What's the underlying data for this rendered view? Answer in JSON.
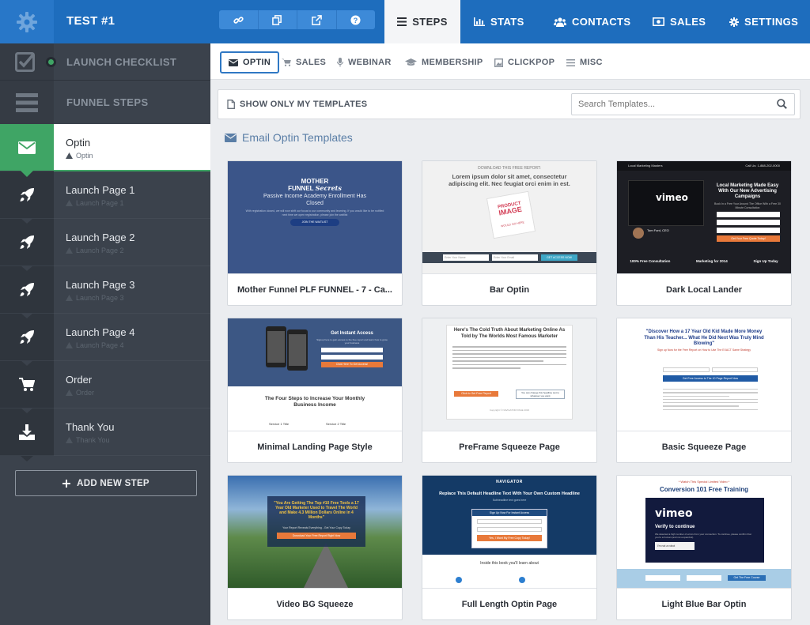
{
  "app": {
    "title": "TEST #1"
  },
  "toolbar": {
    "icons": [
      "link-icon",
      "copy-icon",
      "external-link-icon",
      "help-icon"
    ]
  },
  "nav": {
    "tabs": [
      {
        "label": "STEPS",
        "icon": "list-icon",
        "active": true
      },
      {
        "label": "STATS",
        "icon": "bar-chart-icon",
        "active": false
      },
      {
        "label": "CONTACTS",
        "icon": "users-icon",
        "active": false
      },
      {
        "label": "SALES",
        "icon": "money-icon",
        "active": false
      },
      {
        "label": "SETTINGS",
        "icon": "gear-icon",
        "active": false
      }
    ]
  },
  "sidebar": {
    "checklist_label": "LAUNCH CHECKLIST",
    "funnel_steps_label": "FUNNEL STEPS",
    "steps": [
      {
        "name": "Optin",
        "sub": "Optin",
        "icon": "envelope-icon",
        "active": true
      },
      {
        "name": "Launch Page 1",
        "sub": "Launch Page 1",
        "icon": "rocket-icon"
      },
      {
        "name": "Launch Page 2",
        "sub": "Launch Page 2",
        "icon": "rocket-icon"
      },
      {
        "name": "Launch Page 3",
        "sub": "Launch Page 3",
        "icon": "rocket-icon"
      },
      {
        "name": "Launch Page 4",
        "sub": "Launch Page 4",
        "icon": "rocket-icon"
      },
      {
        "name": "Order",
        "sub": "Order",
        "icon": "cart-icon"
      },
      {
        "name": "Thank You",
        "sub": "Thank You",
        "icon": "download-icon"
      }
    ],
    "add_step_label": "ADD NEW STEP"
  },
  "subnav": {
    "tabs": [
      {
        "label": "OPTIN",
        "icon": "envelope-icon",
        "active": true
      },
      {
        "label": "SALES",
        "icon": "cart-icon"
      },
      {
        "label": "WEBINAR",
        "icon": "microphone-icon"
      },
      {
        "label": "MEMBERSHIP",
        "icon": "graduation-cap-icon"
      },
      {
        "label": "CLICKPOP",
        "icon": "image-icon"
      },
      {
        "label": "MISC",
        "icon": "menu-icon"
      }
    ]
  },
  "filter": {
    "only_my_label": "SHOW ONLY MY TEMPLATES",
    "search_placeholder": "Search Templates..."
  },
  "section": {
    "title": "Email Optin Templates"
  },
  "templates": [
    {
      "name": "Mother Funnel PLF FUNNEL - 7 - Ca..."
    },
    {
      "name": "Bar Optin"
    },
    {
      "name": "Dark Local Lander"
    },
    {
      "name": "Minimal Landing Page Style"
    },
    {
      "name": "PreFrame Squeeze Page"
    },
    {
      "name": "Basic Squeeze Page"
    },
    {
      "name": "Video BG Squeeze"
    },
    {
      "name": "Full Length Optin Page"
    },
    {
      "name": "Light Blue Bar Optin"
    }
  ],
  "thumbs": {
    "t1": {
      "brand_a": "MOTHER",
      "brand_b": "FUNNEL",
      "brand_c": "Secrets",
      "headline": "Passive Income Academy Enrollment Has Closed",
      "body": "With registration closed, we will now shift our focus to our community and learning. If you would like to be notified next time we open registration, please join the waitlist",
      "cta": "JOIN THE WAITLIST"
    },
    "t2": {
      "kicker": "DOWNLOAD THIS FREE REPORT:",
      "headline": "Lorem ipsum dolor sit amet, consectetur adipiscing elit. Nec feugiat orci enim in est.",
      "product_a": "PRODUCT",
      "product_b": "IMAGE",
      "product_c": "WOULD GO HERE",
      "field1": "Enter Your Name",
      "field2": "Enter Your Email",
      "cta": "GET ACCESS NOW"
    },
    "t3": {
      "brand": "Local Marketing Masters",
      "phone": "Call Us: 1-888-202-0000",
      "headline": "Local Marketing Made Easy With Our New Advertising Campaigns",
      "sub": "Book In a Free Your Around The Office With a Free 30 Minute Consultation",
      "person": "Tom Ford, CEO",
      "c1": "100% Free Consultation",
      "c2": "Marketing for 2014",
      "c3": "Sign Up Today",
      "cta": "Get Your Free Quote Today!"
    },
    "t4": {
      "headline": "Get Instant Access",
      "body": "Signup here to gain access to the free report and learn how to grow your business",
      "cta": "Click Here To Get Access!",
      "section": "The Four Steps to Increase Your Monthly Business Income",
      "step1": "Service 1 Title",
      "step2": "Service 2 Title"
    },
    "t5": {
      "headline": "Here's The Cold Truth About Marketing Online As Told by The Worlds Most Famous Marketer",
      "cta": "Click to Get Free Report",
      "side": "You can change this headline text to whatever you want",
      "footer": "Copyright © NAVIGATOR PAGE 2016"
    },
    "t6": {
      "headline": "\"Discover How a 17 Year Old Kid Made More Money Than His Teacher... What He Did Next Was Truly Mind Blowing\"",
      "sub": "Sign up Now for the Free Report on How to Use The EXACT Same Strategy",
      "cta": "Get Free Access to The 10 Page Report Now"
    },
    "t7": {
      "headline": "\"You Are Getting The Top #10 Free Tools a 17 Year Old Marketer Used to Travel The World and Make 4.3 Million Dollars Online in 4 Months\"",
      "sub": "Your Report Reveals Everything - Get Your Copy Today",
      "cta": "Download Your Free Report Right Now"
    },
    "t8": {
      "brand": "NAVIGATOR",
      "headline": "Replace This Default Headline Text With Your Own Custom Headline",
      "sub": "Subheadline text goes here",
      "form_title": "Sign Up Now For Instant Access",
      "cta": "Yes, I Want My Free Copy Today!",
      "section": "Inside this book you'll learn about"
    },
    "t9": {
      "kicker": "* Watch This Special Limited Video *",
      "headline": "Conversion 101 Free Training",
      "vimeo": "vimeo",
      "verify": "Verify to continue",
      "verify_sub": "We detected a high number of errors from your connection. To continue, please confirm that you're a human (and not a spambot).",
      "check": "I'm not a robot",
      "cta": "Get The Free Course"
    }
  }
}
